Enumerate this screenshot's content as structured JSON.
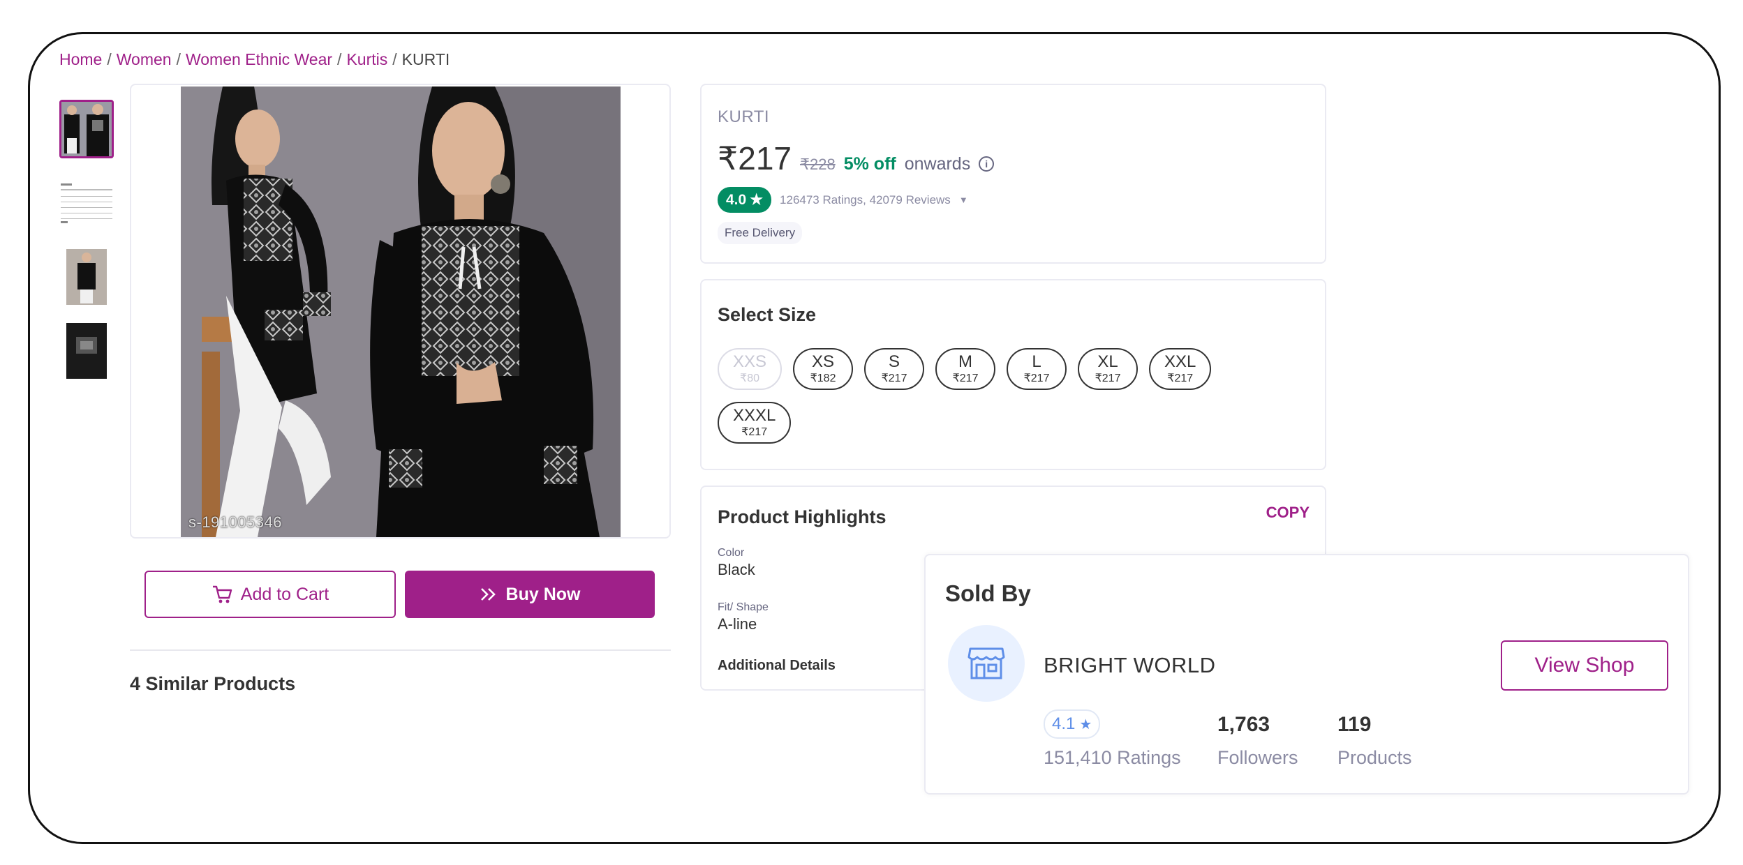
{
  "breadcrumb": {
    "items": [
      "Home",
      "Women",
      "Women Ethnic Wear",
      "Kurtis"
    ],
    "current": "KURTI"
  },
  "thumbnails": [
    {
      "name": "kurti-two-poses",
      "active": true
    },
    {
      "name": "size-chart",
      "active": false
    },
    {
      "name": "kurti-standing",
      "active": false
    },
    {
      "name": "kurti-closeup",
      "active": false
    }
  ],
  "main_image": {
    "code": "s-191005346"
  },
  "actions": {
    "add_to_cart": "Add to Cart",
    "buy_now": "Buy Now"
  },
  "similar": {
    "label": "4 Similar Products"
  },
  "product": {
    "name": "KURTI",
    "price": "₹217",
    "mrp": "₹228",
    "discount": "5% off",
    "onwards": "onwards",
    "rating": "4.0",
    "ratings_text": "126473 Ratings, 42079 Reviews",
    "delivery": "Free Delivery"
  },
  "size_section": {
    "title": "Select Size",
    "sizes": [
      {
        "size": "XXS",
        "price": "₹80",
        "available": false
      },
      {
        "size": "XS",
        "price": "₹182",
        "available": true
      },
      {
        "size": "S",
        "price": "₹217",
        "available": true
      },
      {
        "size": "M",
        "price": "₹217",
        "available": true
      },
      {
        "size": "L",
        "price": "₹217",
        "available": true
      },
      {
        "size": "XL",
        "price": "₹217",
        "available": true
      },
      {
        "size": "XXL",
        "price": "₹217",
        "available": true
      },
      {
        "size": "XXXL",
        "price": "₹217",
        "available": true
      }
    ]
  },
  "highlights": {
    "title": "Product Highlights",
    "copy": "COPY",
    "items": [
      {
        "label": "Color",
        "value": "Black"
      },
      {
        "label": "Fit/ Shape",
        "value": "A-line"
      }
    ],
    "additional": "Additional Details"
  },
  "seller": {
    "title": "Sold By",
    "name": "BRIGHT WORLD",
    "view_shop": "View Shop",
    "rating": "4.1",
    "ratings": "151,410",
    "ratings_label": "Ratings",
    "followers": "1,763",
    "followers_label": "Followers",
    "products": "119",
    "products_label": "Products"
  },
  "colors": {
    "accent": "#9f2089",
    "green": "#038d63",
    "seller_blue": "#5e8ee8"
  }
}
